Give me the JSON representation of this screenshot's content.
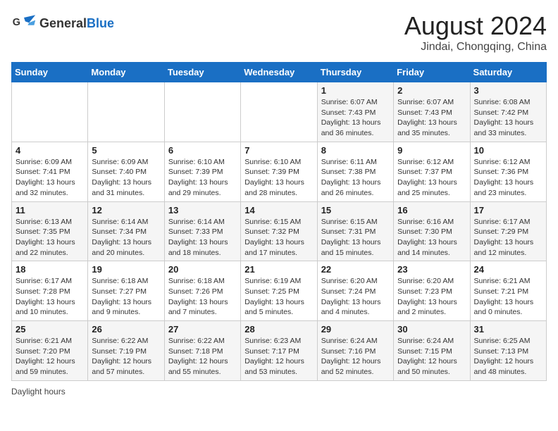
{
  "logo": {
    "text_general": "General",
    "text_blue": "Blue"
  },
  "header": {
    "title": "August 2024",
    "subtitle": "Jindai, Chongqing, China"
  },
  "days_of_week": [
    "Sunday",
    "Monday",
    "Tuesday",
    "Wednesday",
    "Thursday",
    "Friday",
    "Saturday"
  ],
  "weeks": [
    [
      {
        "day": "",
        "sunrise": "",
        "sunset": "",
        "daylight": ""
      },
      {
        "day": "",
        "sunrise": "",
        "sunset": "",
        "daylight": ""
      },
      {
        "day": "",
        "sunrise": "",
        "sunset": "",
        "daylight": ""
      },
      {
        "day": "",
        "sunrise": "",
        "sunset": "",
        "daylight": ""
      },
      {
        "day": "1",
        "sunrise": "Sunrise: 6:07 AM",
        "sunset": "Sunset: 7:43 PM",
        "daylight": "Daylight: 13 hours and 36 minutes."
      },
      {
        "day": "2",
        "sunrise": "Sunrise: 6:07 AM",
        "sunset": "Sunset: 7:43 PM",
        "daylight": "Daylight: 13 hours and 35 minutes."
      },
      {
        "day": "3",
        "sunrise": "Sunrise: 6:08 AM",
        "sunset": "Sunset: 7:42 PM",
        "daylight": "Daylight: 13 hours and 33 minutes."
      }
    ],
    [
      {
        "day": "4",
        "sunrise": "Sunrise: 6:09 AM",
        "sunset": "Sunset: 7:41 PM",
        "daylight": "Daylight: 13 hours and 32 minutes."
      },
      {
        "day": "5",
        "sunrise": "Sunrise: 6:09 AM",
        "sunset": "Sunset: 7:40 PM",
        "daylight": "Daylight: 13 hours and 31 minutes."
      },
      {
        "day": "6",
        "sunrise": "Sunrise: 6:10 AM",
        "sunset": "Sunset: 7:39 PM",
        "daylight": "Daylight: 13 hours and 29 minutes."
      },
      {
        "day": "7",
        "sunrise": "Sunrise: 6:10 AM",
        "sunset": "Sunset: 7:39 PM",
        "daylight": "Daylight: 13 hours and 28 minutes."
      },
      {
        "day": "8",
        "sunrise": "Sunrise: 6:11 AM",
        "sunset": "Sunset: 7:38 PM",
        "daylight": "Daylight: 13 hours and 26 minutes."
      },
      {
        "day": "9",
        "sunrise": "Sunrise: 6:12 AM",
        "sunset": "Sunset: 7:37 PM",
        "daylight": "Daylight: 13 hours and 25 minutes."
      },
      {
        "day": "10",
        "sunrise": "Sunrise: 6:12 AM",
        "sunset": "Sunset: 7:36 PM",
        "daylight": "Daylight: 13 hours and 23 minutes."
      }
    ],
    [
      {
        "day": "11",
        "sunrise": "Sunrise: 6:13 AM",
        "sunset": "Sunset: 7:35 PM",
        "daylight": "Daylight: 13 hours and 22 minutes."
      },
      {
        "day": "12",
        "sunrise": "Sunrise: 6:14 AM",
        "sunset": "Sunset: 7:34 PM",
        "daylight": "Daylight: 13 hours and 20 minutes."
      },
      {
        "day": "13",
        "sunrise": "Sunrise: 6:14 AM",
        "sunset": "Sunset: 7:33 PM",
        "daylight": "Daylight: 13 hours and 18 minutes."
      },
      {
        "day": "14",
        "sunrise": "Sunrise: 6:15 AM",
        "sunset": "Sunset: 7:32 PM",
        "daylight": "Daylight: 13 hours and 17 minutes."
      },
      {
        "day": "15",
        "sunrise": "Sunrise: 6:15 AM",
        "sunset": "Sunset: 7:31 PM",
        "daylight": "Daylight: 13 hours and 15 minutes."
      },
      {
        "day": "16",
        "sunrise": "Sunrise: 6:16 AM",
        "sunset": "Sunset: 7:30 PM",
        "daylight": "Daylight: 13 hours and 14 minutes."
      },
      {
        "day": "17",
        "sunrise": "Sunrise: 6:17 AM",
        "sunset": "Sunset: 7:29 PM",
        "daylight": "Daylight: 13 hours and 12 minutes."
      }
    ],
    [
      {
        "day": "18",
        "sunrise": "Sunrise: 6:17 AM",
        "sunset": "Sunset: 7:28 PM",
        "daylight": "Daylight: 13 hours and 10 minutes."
      },
      {
        "day": "19",
        "sunrise": "Sunrise: 6:18 AM",
        "sunset": "Sunset: 7:27 PM",
        "daylight": "Daylight: 13 hours and 9 minutes."
      },
      {
        "day": "20",
        "sunrise": "Sunrise: 6:18 AM",
        "sunset": "Sunset: 7:26 PM",
        "daylight": "Daylight: 13 hours and 7 minutes."
      },
      {
        "day": "21",
        "sunrise": "Sunrise: 6:19 AM",
        "sunset": "Sunset: 7:25 PM",
        "daylight": "Daylight: 13 hours and 5 minutes."
      },
      {
        "day": "22",
        "sunrise": "Sunrise: 6:20 AM",
        "sunset": "Sunset: 7:24 PM",
        "daylight": "Daylight: 13 hours and 4 minutes."
      },
      {
        "day": "23",
        "sunrise": "Sunrise: 6:20 AM",
        "sunset": "Sunset: 7:23 PM",
        "daylight": "Daylight: 13 hours and 2 minutes."
      },
      {
        "day": "24",
        "sunrise": "Sunrise: 6:21 AM",
        "sunset": "Sunset: 7:21 PM",
        "daylight": "Daylight: 13 hours and 0 minutes."
      }
    ],
    [
      {
        "day": "25",
        "sunrise": "Sunrise: 6:21 AM",
        "sunset": "Sunset: 7:20 PM",
        "daylight": "Daylight: 12 hours and 59 minutes."
      },
      {
        "day": "26",
        "sunrise": "Sunrise: 6:22 AM",
        "sunset": "Sunset: 7:19 PM",
        "daylight": "Daylight: 12 hours and 57 minutes."
      },
      {
        "day": "27",
        "sunrise": "Sunrise: 6:22 AM",
        "sunset": "Sunset: 7:18 PM",
        "daylight": "Daylight: 12 hours and 55 minutes."
      },
      {
        "day": "28",
        "sunrise": "Sunrise: 6:23 AM",
        "sunset": "Sunset: 7:17 PM",
        "daylight": "Daylight: 12 hours and 53 minutes."
      },
      {
        "day": "29",
        "sunrise": "Sunrise: 6:24 AM",
        "sunset": "Sunset: 7:16 PM",
        "daylight": "Daylight: 12 hours and 52 minutes."
      },
      {
        "day": "30",
        "sunrise": "Sunrise: 6:24 AM",
        "sunset": "Sunset: 7:15 PM",
        "daylight": "Daylight: 12 hours and 50 minutes."
      },
      {
        "day": "31",
        "sunrise": "Sunrise: 6:25 AM",
        "sunset": "Sunset: 7:13 PM",
        "daylight": "Daylight: 12 hours and 48 minutes."
      }
    ]
  ],
  "legend": {
    "daylight_label": "Daylight hours"
  }
}
